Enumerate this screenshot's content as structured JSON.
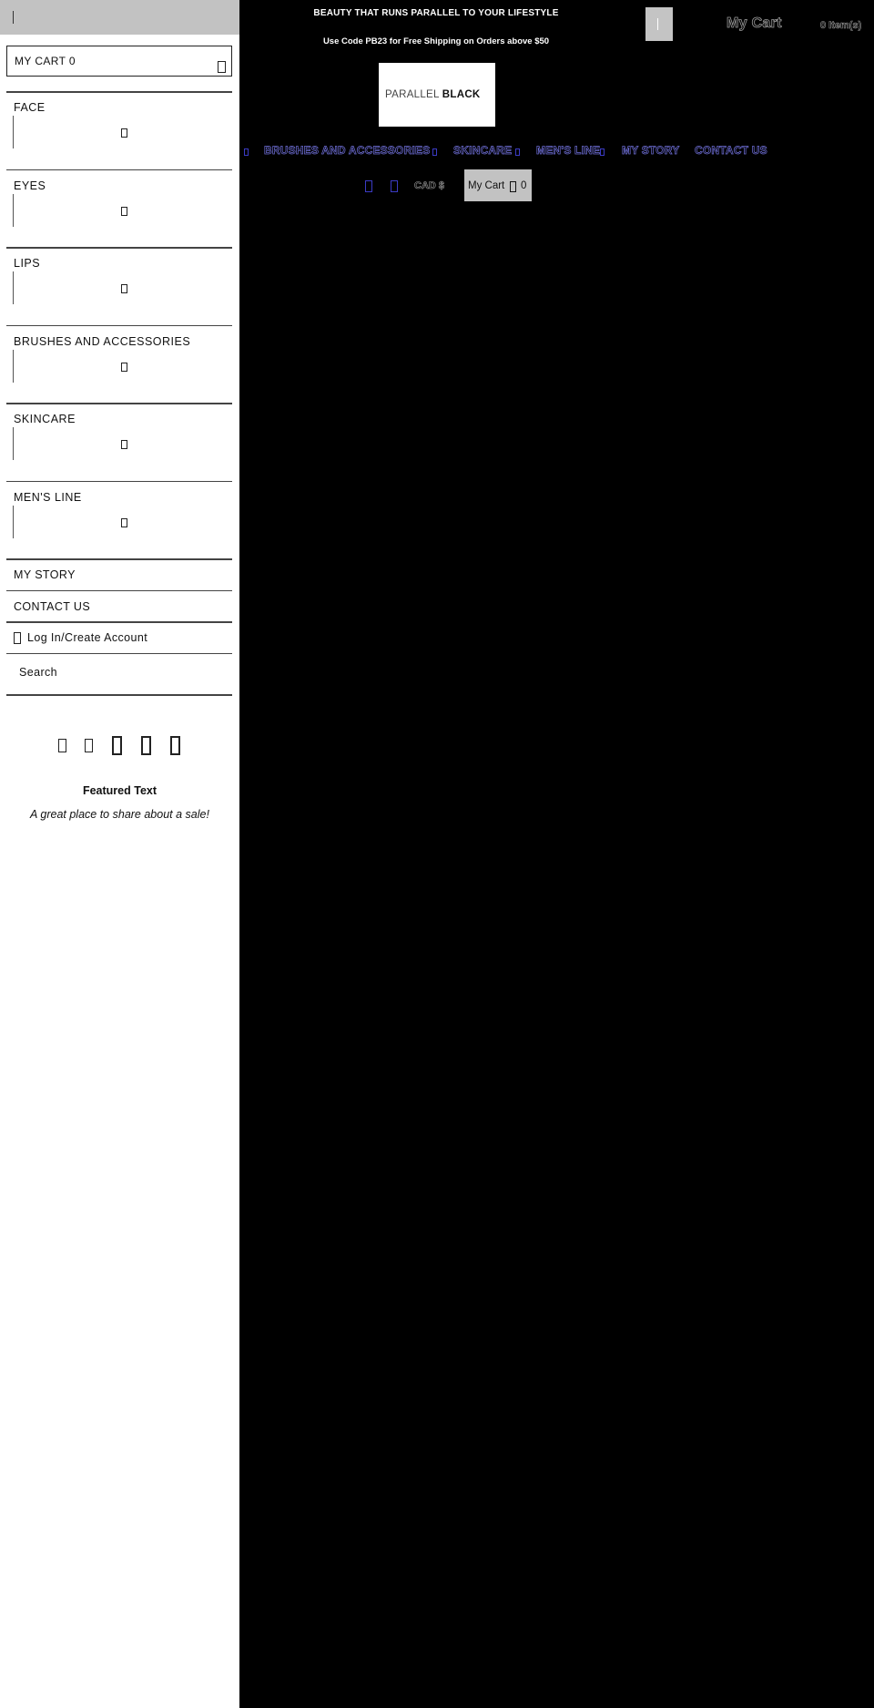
{
  "drawer": {
    "cart_label": "MY CART",
    "cart_count": "0",
    "sections": [
      {
        "title": "FACE"
      },
      {
        "title": "EYES"
      },
      {
        "title": "LIPS"
      },
      {
        "title": "BRUSHES AND ACCESSORIES"
      },
      {
        "title": "SKINCARE"
      },
      {
        "title": "MEN'S LINE"
      }
    ],
    "my_story": "MY STORY",
    "contact_us": "CONTACT US",
    "login": "Log In/Create Account",
    "search_placeholder": "Search",
    "social_icons": [
      "facebook-icon",
      "twitter-icon",
      "instagram-icon",
      "pinterest-icon",
      "youtube-icon"
    ],
    "featured_title": "Featured Text",
    "featured_text": "A great place to share about a sale!"
  },
  "header": {
    "announcement": "BEAUTY THAT RUNS PARALLEL TO YOUR LIFESTYLE",
    "promo": "Use Code PB23 for Free Shipping on Orders above $50",
    "cart_title": "My Cart",
    "cart_items": "0 Item(s)",
    "logo_light": "PARALLEL",
    "logo_bold": "BLACK"
  },
  "nav": {
    "items": [
      {
        "label": "BRUSHES AND ACCESSORIES"
      },
      {
        "label": "SKINCARE"
      },
      {
        "label": "MEN'S LINE"
      },
      {
        "label": "MY STORY"
      },
      {
        "label": "CONTACT US"
      }
    ]
  },
  "utility": {
    "currency": "CAD $",
    "cart_label": "My Cart",
    "cart_count": "0"
  },
  "colors": {
    "drawer_bg": "#ffffff",
    "page_bg": "#000000",
    "nav_link": "#6f6fd8",
    "cart_button_bg": "#c2c2c2"
  }
}
